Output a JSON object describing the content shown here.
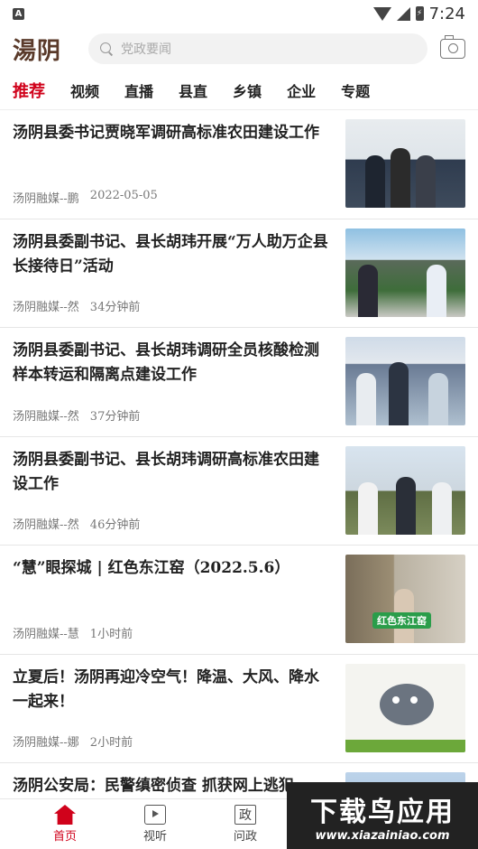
{
  "status_bar": {
    "time": "7:24",
    "app_badge": "A"
  },
  "header": {
    "logo": "湯阴",
    "search_placeholder": "党政要闻"
  },
  "tabs": [
    {
      "label": "推荐",
      "active": true
    },
    {
      "label": "视频"
    },
    {
      "label": "直播"
    },
    {
      "label": "县直"
    },
    {
      "label": "乡镇"
    },
    {
      "label": "企业"
    },
    {
      "label": "专题"
    }
  ],
  "news": [
    {
      "title": "汤阴县委书记贾晓军调研高标准农田建设工作",
      "source": "汤阴融媒--鹏",
      "time": "2022-05-05"
    },
    {
      "title": "汤阴县委副书记、县长胡玮开展“万人助万企县长接待日”活动",
      "source": "汤阴融媒--然",
      "time": "34分钟前"
    },
    {
      "title": "汤阴县委副书记、县长胡玮调研全员核酸检测样本转运和隔离点建设工作",
      "source": "汤阴融媒--然",
      "time": "37分钟前"
    },
    {
      "title": "汤阴县委副书记、县长胡玮调研高标准农田建设工作",
      "source": "汤阴融媒--然",
      "time": "46分钟前"
    },
    {
      "title": "“慧”眼探城 | 红色东江窑（2022.5.6）",
      "source": "汤阴融媒--慧",
      "time": "1小时前",
      "thumb_label": "红色东江窑"
    },
    {
      "title": "立夏后！汤阴再迎冷空气！降温、大风、降水一起来！",
      "source": "汤阴融媒--娜",
      "time": "2小时前"
    },
    {
      "title": "汤阴公安局：民警缜密侦查 抓获网上逃犯",
      "source": "",
      "time": ""
    }
  ],
  "bottom_nav": [
    {
      "label": "首页",
      "icon": "home-icon",
      "active": true
    },
    {
      "label": "视听",
      "icon": "tv-icon"
    },
    {
      "label": "问政",
      "icon": "zheng-icon",
      "glyph": "政"
    }
  ],
  "watermark": {
    "title": "下载鸟应用",
    "url": "www.xiazainiao.com"
  }
}
